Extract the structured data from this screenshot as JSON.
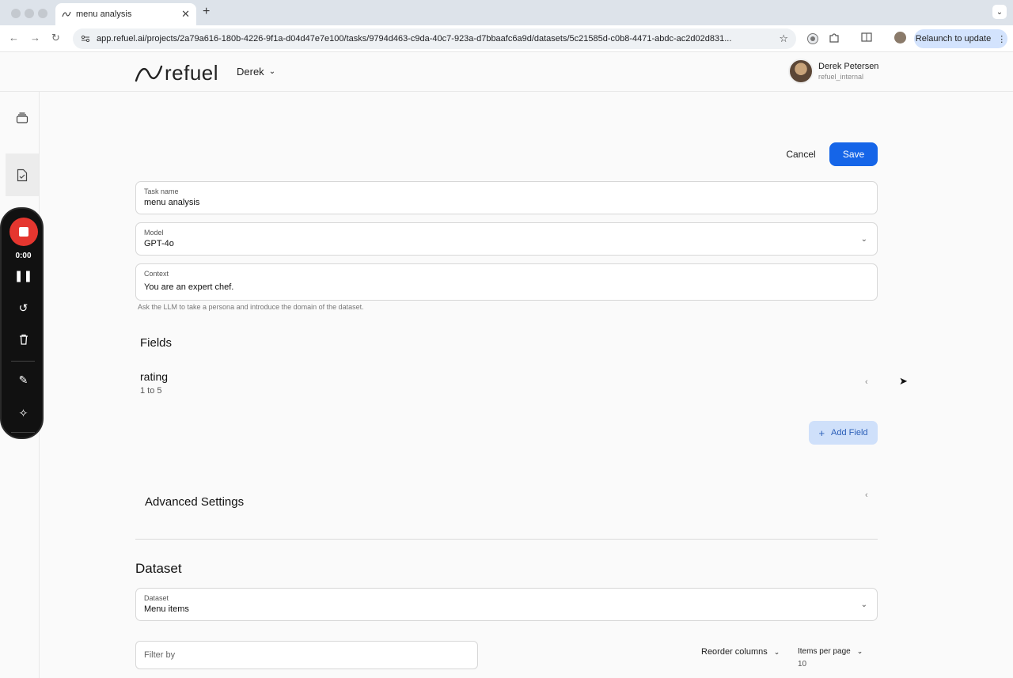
{
  "browser": {
    "tab_title": "menu analysis",
    "tab_close": "✕",
    "new_tab": "+",
    "tab_menu": "⌄",
    "url": "app.refuel.ai/projects/2a79a616-180b-4226-9f1a-d04d47e7e100/tasks/9794d463-c9da-40c7-923a-d7bbaafc6a9d/datasets/5c21585d-c0b8-4471-abdc-ac2d02d831...",
    "relaunch_label": "Relaunch to update",
    "relaunch_menu": "⋮",
    "back": "←",
    "forward": "→",
    "reload": "↻",
    "star": "☆"
  },
  "header": {
    "logo_text": "refuel",
    "workspace": "Derek",
    "user_name": "Derek Petersen",
    "user_sub": "refuel_internal"
  },
  "recorder": {
    "time": "0:00"
  },
  "actions": {
    "cancel": "Cancel",
    "save": "Save"
  },
  "form": {
    "task_name_label": "Task name",
    "task_name_value": "menu analysis",
    "model_label": "Model",
    "model_value": "GPT-4o",
    "context_label": "Context",
    "context_value": "You are an expert chef.",
    "context_helper": "Ask the LLM to take a persona and introduce the domain of the dataset."
  },
  "fields": {
    "title": "Fields",
    "items": [
      {
        "name": "rating",
        "description": "1 to 5"
      }
    ],
    "add_label": "Add Field"
  },
  "advanced": {
    "title": "Advanced Settings"
  },
  "dataset": {
    "title": "Dataset",
    "select_label": "Dataset",
    "select_value": "Menu items",
    "filter_placeholder": "Filter by",
    "reorder_label": "Reorder columns",
    "items_per_page_label": "Items per page",
    "items_per_page_value": "10"
  }
}
